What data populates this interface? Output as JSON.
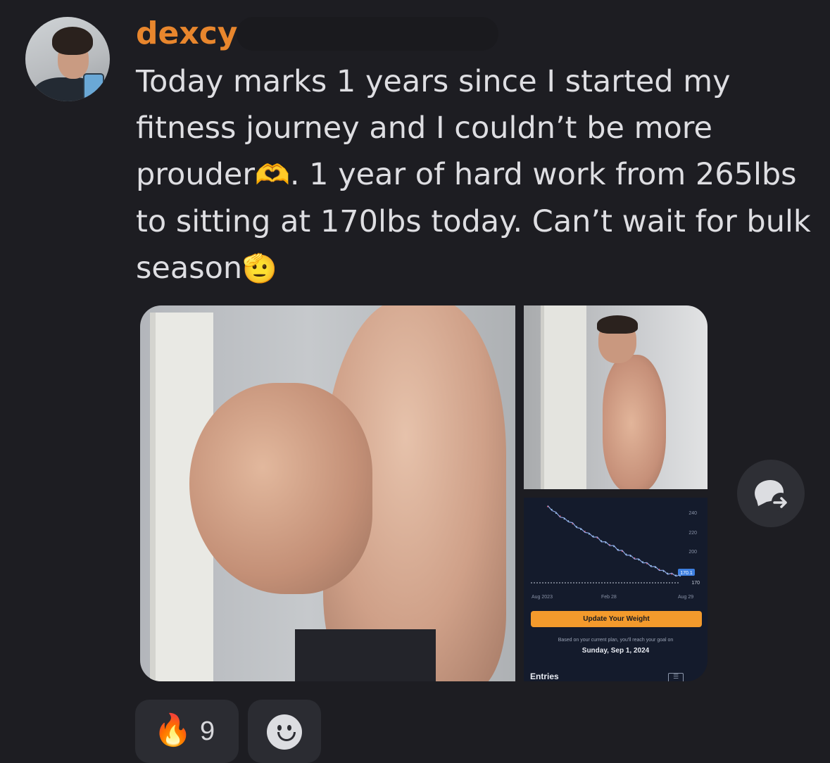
{
  "author": {
    "username": "dexcy",
    "username_color": "#e8862d"
  },
  "message": {
    "text_part1": "Today marks 1 years since I started my fitness journey and I couldn’t be more prouder",
    "emoji1": "🫶",
    "text_part2": ". 1 year of hard work from 265lbs to sitting at 170lbs today. Can’t wait for bulk season",
    "emoji2": "🫡"
  },
  "attachments": {
    "main_photo": "after-photo",
    "side_photo": "before-photo",
    "weight_app": {
      "y_tick_labels": [
        "240",
        "220",
        "200",
        "170"
      ],
      "x_tick_labels": [
        "Aug 2023",
        "Feb 28",
        "Aug 29"
      ],
      "current_badge": "170.1",
      "update_button": "Update Your Weight",
      "plan_note": "Based on your current plan, you'll reach your goal on",
      "plan_date": "Sunday, Sep 1, 2024",
      "entries_label": "Entries",
      "accent_color": "#f39a2c",
      "line_color": "#8fa7e6",
      "chart_data": {
        "type": "line",
        "y_scale": [
          160,
          245
        ],
        "goal_line": 170,
        "series": [
          {
            "values": [
              243,
              240,
              236,
              233,
              230,
              228,
              225,
              222,
              219,
              217,
              214,
              212,
              210,
              207,
              205,
              203,
              201,
              198,
              196,
              193,
              191,
              189,
              187,
              185,
              183,
              181,
              179,
              177,
              175,
              173,
              172,
              171,
              170.1
            ]
          }
        ]
      }
    }
  },
  "actions": {
    "share_icon": "forward-thread-icon"
  },
  "reactions": [
    {
      "emoji": "🔥",
      "count": "9"
    }
  ],
  "add_reaction_icon": "smile-add-reaction-icon"
}
